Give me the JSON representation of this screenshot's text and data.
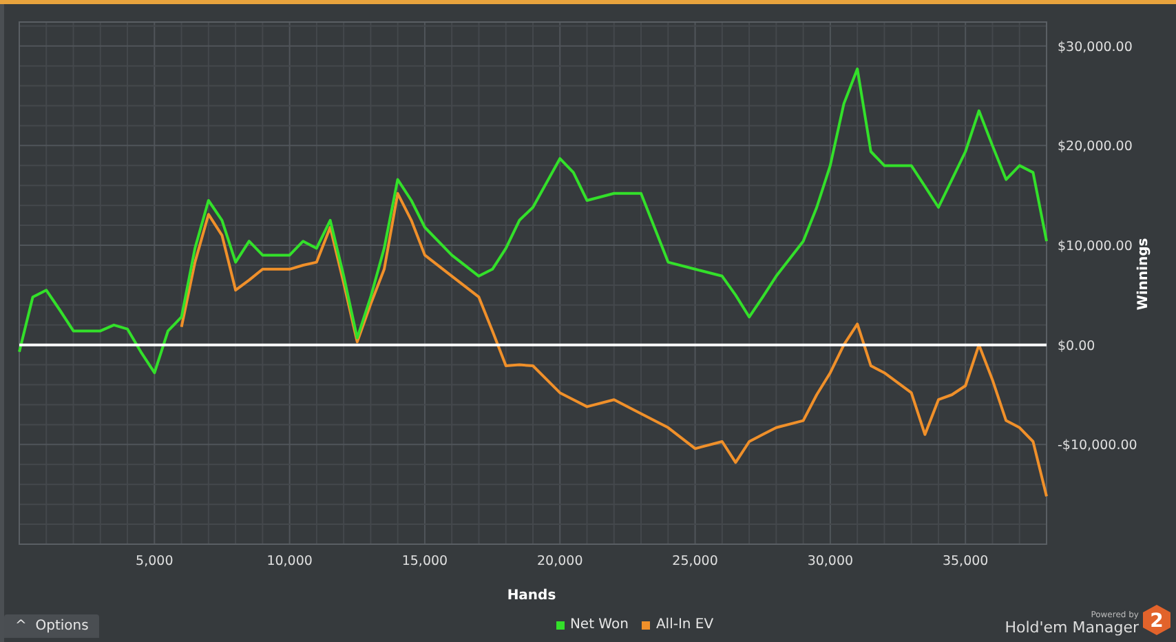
{
  "chart": {
    "chart_data": {
      "type": "line",
      "xlabel": "Hands",
      "ylabel": "Winnings",
      "x": [
        0,
        500,
        1000,
        1500,
        2000,
        3000,
        3500,
        4000,
        4500,
        5000,
        5500,
        6000,
        6500,
        7000,
        7500,
        8000,
        8500,
        9000,
        10000,
        10500,
        11000,
        11500,
        12000,
        12500,
        13000,
        13500,
        14000,
        14500,
        15000,
        16000,
        17000,
        17500,
        18000,
        18500,
        19000,
        20000,
        20500,
        21000,
        22000,
        23000,
        24000,
        25000,
        26000,
        26500,
        27000,
        27500,
        28000,
        29000,
        29500,
        30000,
        30500,
        31000,
        31500,
        32000,
        33000,
        33500,
        34000,
        34500,
        35000,
        35500,
        36000,
        36500,
        37000,
        37500,
        38000
      ],
      "series": [
        {
          "name": "Net Won",
          "color": "#33e02a",
          "values": [
            -700,
            4800,
            5500,
            3500,
            1400,
            1400,
            2000,
            1600,
            -700,
            -2800,
            1400,
            2800,
            9700,
            14500,
            12500,
            8300,
            10400,
            9000,
            9000,
            10400,
            9700,
            12500,
            6900,
            700,
            4800,
            9700,
            16600,
            14500,
            11800,
            9000,
            6900,
            7600,
            9700,
            12500,
            13800,
            18700,
            17300,
            14500,
            15200,
            15200,
            8300,
            7600,
            6900,
            5000,
            2800,
            4800,
            6900,
            10400,
            13800,
            18000,
            24200,
            27700,
            19400,
            18000,
            18000,
            15900,
            13800,
            16600,
            19400,
            23500,
            20000,
            16600,
            18000,
            17300,
            10400
          ]
        },
        {
          "name": "All-In EV",
          "color": "#f0902a",
          "values": [
            null,
            null,
            null,
            null,
            null,
            null,
            null,
            null,
            null,
            null,
            null,
            1800,
            8300,
            13100,
            11000,
            5500,
            6500,
            7600,
            7600,
            8000,
            8300,
            11800,
            6200,
            300,
            4100,
            7600,
            15200,
            12500,
            9000,
            6900,
            4800,
            1400,
            -2100,
            -2000,
            -2100,
            -4800,
            -5500,
            -6200,
            -5500,
            -6900,
            -8300,
            -10400,
            -9700,
            -11800,
            -9700,
            -9000,
            -8300,
            -7600,
            -5000,
            -2800,
            0,
            2100,
            -2100,
            -2800,
            -4800,
            -9000,
            -5500,
            -5000,
            -4100,
            0,
            -3500,
            -7600,
            -8300,
            -9700,
            -15200
          ]
        }
      ],
      "grid": true,
      "xlim": [
        0,
        38000
      ],
      "ylim": [
        -20000,
        32400
      ],
      "xticks": [
        {
          "value": 5000,
          "label": "5,000"
        },
        {
          "value": 10000,
          "label": "10,000"
        },
        {
          "value": 15000,
          "label": "15,000"
        },
        {
          "value": 20000,
          "label": "20,000"
        },
        {
          "value": 25000,
          "label": "25,000"
        },
        {
          "value": 30000,
          "label": "30,000"
        },
        {
          "value": 35000,
          "label": "35,000"
        }
      ],
      "yticks": [
        {
          "value": -10000,
          "label": "-$10,000.00"
        },
        {
          "value": 0,
          "label": "$0.00"
        },
        {
          "value": 10000,
          "label": "$10,000.00"
        },
        {
          "value": 20000,
          "label": "$20,000.00"
        },
        {
          "value": 30000,
          "label": "$30,000.00"
        }
      ]
    }
  },
  "options_button": {
    "caret": "^",
    "label": "Options"
  },
  "branding": {
    "powered_by": "Powered by",
    "product": "Hold'em Manager",
    "version": "2"
  }
}
